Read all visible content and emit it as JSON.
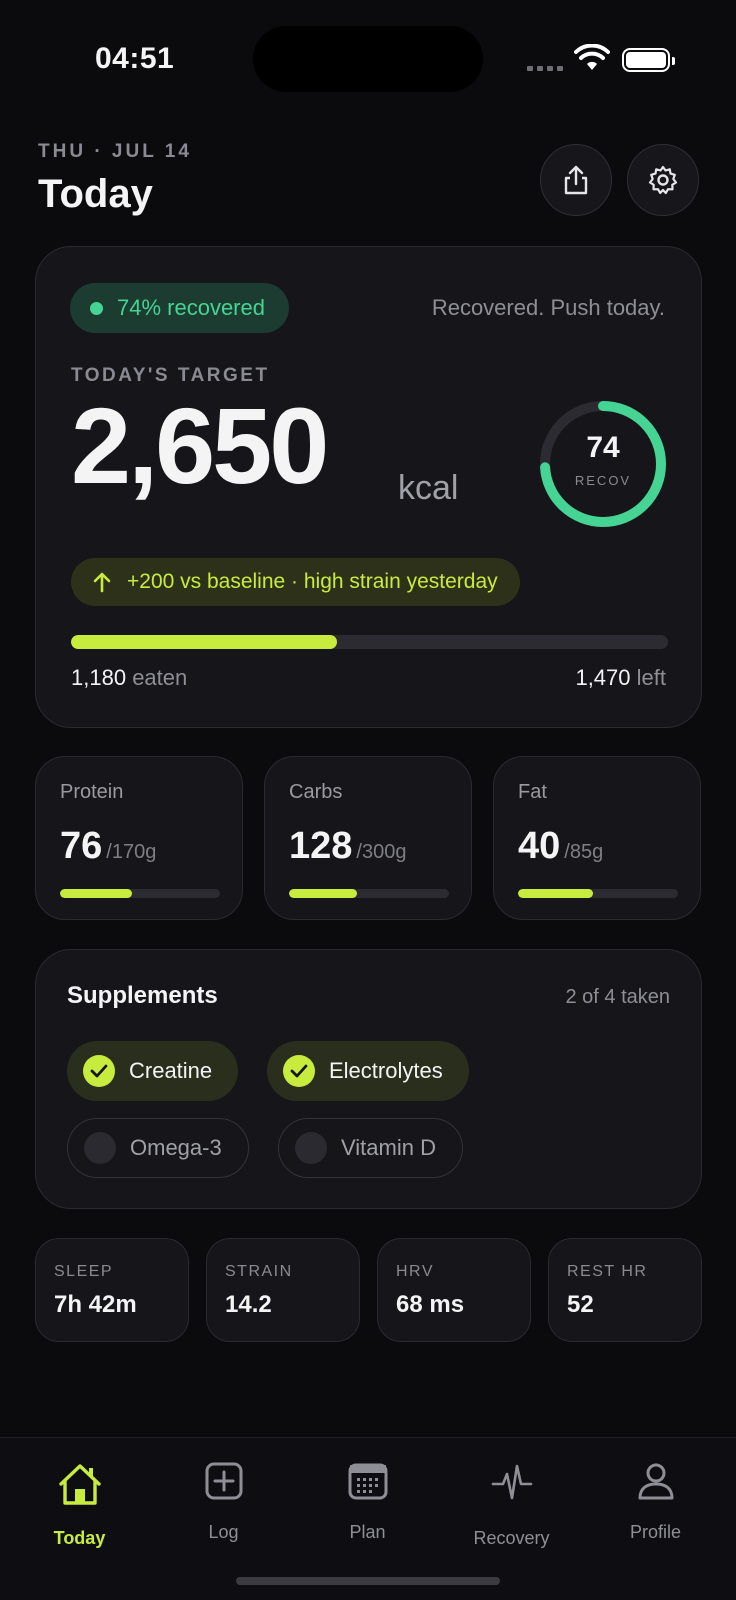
{
  "status": {
    "time": "04:51"
  },
  "header": {
    "date": "THU · JUL 14",
    "title": "Today"
  },
  "hero": {
    "recovery_pill": "74% recovered",
    "note": "Recovered. Push today.",
    "target_label": "TODAY'S TARGET",
    "kcal": "2,650",
    "unit": "kcal",
    "ring_value": "74",
    "ring_label": "RECOV",
    "ring_fraction": 0.74,
    "delta_text": "+200 vs baseline · high strain yesterday",
    "eaten_value": "1,180",
    "eaten_label": "eaten",
    "left_value": "1,470",
    "left_label": "left",
    "progress_fraction": 0.445
  },
  "macros": [
    {
      "name": "Protein",
      "value": "76",
      "goal": "/170g",
      "fraction": 0.447
    },
    {
      "name": "Carbs",
      "value": "128",
      "goal": "/300g",
      "fraction": 0.427
    },
    {
      "name": "Fat",
      "value": "40",
      "goal": "/85g",
      "fraction": 0.471
    }
  ],
  "supplements": {
    "title": "Supplements",
    "count": "2 of 4 taken",
    "items": [
      {
        "label": "Creatine",
        "taken": true
      },
      {
        "label": "Electrolytes",
        "taken": true
      },
      {
        "label": "Omega-3",
        "taken": false
      },
      {
        "label": "Vitamin D",
        "taken": false
      }
    ]
  },
  "stats": [
    {
      "label": "SLEEP",
      "value": "7h 42m"
    },
    {
      "label": "STRAIN",
      "value": "14.2"
    },
    {
      "label": "HRV",
      "value": "68 ms"
    },
    {
      "label": "REST HR",
      "value": "52"
    }
  ],
  "tabs": [
    {
      "label": "Today",
      "icon": "home-icon",
      "active": true
    },
    {
      "label": "Log",
      "icon": "plus-square-icon",
      "active": false
    },
    {
      "label": "Plan",
      "icon": "calendar-icon",
      "active": false
    },
    {
      "label": "Recovery",
      "icon": "pulse-icon",
      "active": false
    },
    {
      "label": "Profile",
      "icon": "person-icon",
      "active": false
    }
  ],
  "colors": {
    "accent": "#c8ec3d",
    "recovery": "#45d493",
    "background": "#0b0b0e",
    "card": "#15151a"
  }
}
